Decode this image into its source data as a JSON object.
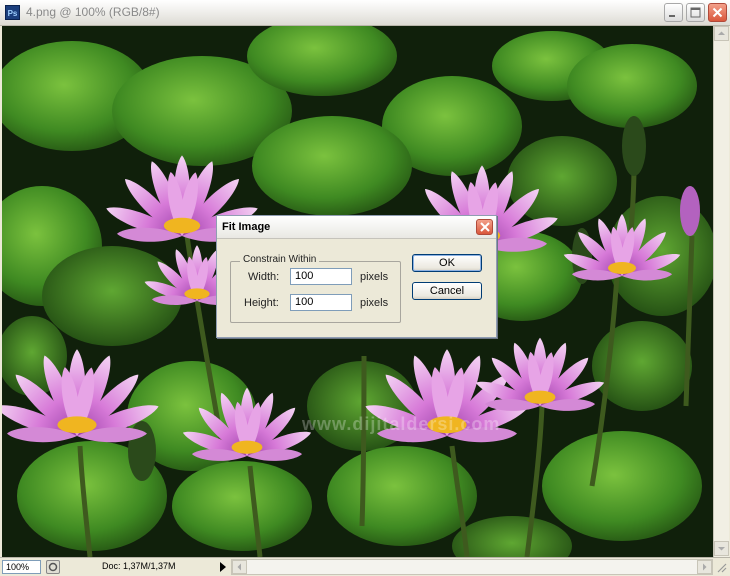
{
  "window": {
    "title": "4.png @ 100% (RGB/8#)",
    "app_icon": "Ps",
    "controls": [
      "minimize-icon",
      "maximize-icon",
      "close-icon"
    ]
  },
  "canvas": {
    "watermark": "www.dijitaldersi.com"
  },
  "dialog": {
    "title": "Fit Image",
    "group_label": "Constrain Within",
    "width_label": "Width:",
    "width_value": "100",
    "width_unit": "pixels",
    "height_label": "Height:",
    "height_value": "100",
    "height_unit": "pixels",
    "ok_label": "OK",
    "cancel_label": "Cancel"
  },
  "statusbar": {
    "zoom": "100%",
    "doc_info": "Doc: 1,37M/1,37M"
  },
  "colors": {
    "close_red": "#d9573c",
    "button_border": "#003c74",
    "field_border": "#7f9db9"
  }
}
